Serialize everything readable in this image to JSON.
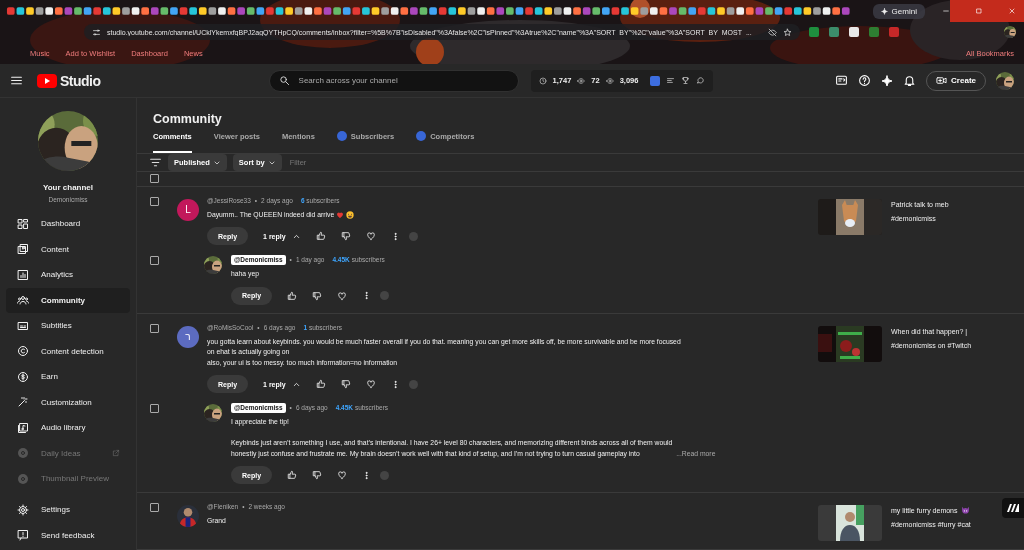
{
  "browser": {
    "tab_title": "Gemini",
    "url": "studio.youtube.com/channel/UCklYkemxfqBPJ2agQYTHpCQ/comments/inbox?filter=%5B%7B\"isDisabled\"%3Afalse%2C\"isPinned\"%3Atrue%2C\"name\"%3A\"SORT_BY\"%2C\"value\"%3A\"SORT_BY_MOST_...",
    "bookmarks": [
      {
        "label": "Music"
      },
      {
        "label": "Add to Wishlist"
      },
      {
        "label": "Dashboard"
      },
      {
        "label": "News"
      }
    ],
    "all_bookmarks": "All Bookmarks"
  },
  "header": {
    "logo": "Studio",
    "search": {
      "placeholder": "Search across your channel"
    },
    "stats": [
      {
        "value": "1,747"
      },
      {
        "value": "72"
      },
      {
        "value": "3,096"
      }
    ],
    "create": "Create"
  },
  "sidebar": {
    "channel_label": "Your channel",
    "channel_name": "Demonicmiss",
    "items": [
      {
        "label": "Dashboard",
        "kind": "main",
        "selected": false
      },
      {
        "label": "Content",
        "kind": "main",
        "selected": false
      },
      {
        "label": "Analytics",
        "kind": "main",
        "selected": false
      },
      {
        "label": "Community",
        "kind": "main",
        "selected": true
      },
      {
        "label": "Subtitles",
        "kind": "main",
        "selected": false
      },
      {
        "label": "Content detection",
        "kind": "main",
        "selected": false
      },
      {
        "label": "Earn",
        "kind": "main",
        "selected": false
      },
      {
        "label": "Customization",
        "kind": "main",
        "selected": false
      },
      {
        "label": "Audio library",
        "kind": "main",
        "selected": false
      },
      {
        "label": "Daily Ideas",
        "kind": "extension",
        "selected": false,
        "external": true
      },
      {
        "label": "Thumbnail Preview",
        "kind": "extension",
        "selected": false,
        "external": false
      }
    ],
    "footer_items": [
      {
        "label": "Settings"
      },
      {
        "label": "Send feedback"
      }
    ]
  },
  "page": {
    "title": "Community",
    "tabs": [
      {
        "label": "Comments",
        "selected": true,
        "badge": false
      },
      {
        "label": "Viewer posts",
        "selected": false,
        "badge": false
      },
      {
        "label": "Mentions",
        "selected": false,
        "badge": false
      },
      {
        "label": "Subscribers",
        "selected": false,
        "badge": true
      },
      {
        "label": "Competitors",
        "selected": false,
        "badge": true
      }
    ],
    "filters": {
      "chips": [
        {
          "label": "Published"
        },
        {
          "label": "Sort by"
        }
      ],
      "placeholder": "Filter"
    },
    "select_all": {
      "checked": false
    },
    "comments": [
      {
        "author": "@JessiRose33",
        "owner": false,
        "separator": "•",
        "time": "2 days ago",
        "subs_count": "6",
        "subs_label": "subscribers",
        "avatar": {
          "kind": "letter",
          "letter": "L",
          "color": "#c2185b"
        },
        "text": "Dayumm.. The QUEEEN indeed did arrive",
        "reactions": [
          {
            "kind": "heart"
          },
          {
            "kind": "laughing"
          }
        ],
        "reply_button": "Reply",
        "reply_count": "1 reply",
        "expanded": true,
        "checked": false,
        "video": {
          "lines": [
            {
              "text": "Patrick talk to meb"
            },
            {
              "text": "#demonicmiss"
            }
          ]
        },
        "replies": [
          {
            "author": "@Demonicmiss",
            "owner": true,
            "separator": "•",
            "time": "1 day ago",
            "subs_count": "4.45K",
            "subs_label": "subscribers",
            "text": "haha yep",
            "reply_button": "Reply",
            "checked": false
          }
        ]
      },
      {
        "author": "@RoMisSoCool",
        "owner": false,
        "separator": "•",
        "time": "6 days ago",
        "subs_count": "1",
        "subs_label": "subscribers",
        "avatar": {
          "kind": "letter",
          "letter": "ר",
          "color": "#5c6bc0"
        },
        "text": "you gotta learn about keybinds. you would be much faster overall if you do that. meaning you can get more skills off, be more survivable and be more focused\non ehat is actually going on\nalso, your ui is too messy. too much information=no information",
        "reply_button": "Reply",
        "reply_count": "1 reply",
        "expanded": true,
        "checked": false,
        "video": {
          "lines": [
            {
              "text": "When did that happen? |"
            },
            {
              "text": "#demonicmiss on #Twitch"
            }
          ]
        },
        "replies": [
          {
            "author": "@Demonicmiss",
            "owner": true,
            "separator": "•",
            "time": "6 days ago",
            "subs_count": "4.45K",
            "subs_label": "subscribers",
            "text": "I appreciate the tip!\n\nKeybinds just aren’t something I use, and that’s intentional. I have 26+ level 80 characters, and memorizing different binds across all of them would\nhonestly just confuse and frustrate me. My brain doesn’t work well with that kind of setup, and I’m not trying to turn casual gameplay into",
            "read_more": "...Read more",
            "reply_button": "Reply",
            "checked": false
          }
        ]
      },
      {
        "author": "@Fleniken",
        "owner": false,
        "separator": "•",
        "time": "2 weeks ago",
        "text": "Grand",
        "checked": false,
        "video": {
          "lines": [
            {
              "text": "my little furry demons",
              "emoji": {
                "kind": "devil"
              }
            },
            {
              "text": "#demonicmiss #furry #cat"
            }
          ]
        }
      }
    ]
  }
}
